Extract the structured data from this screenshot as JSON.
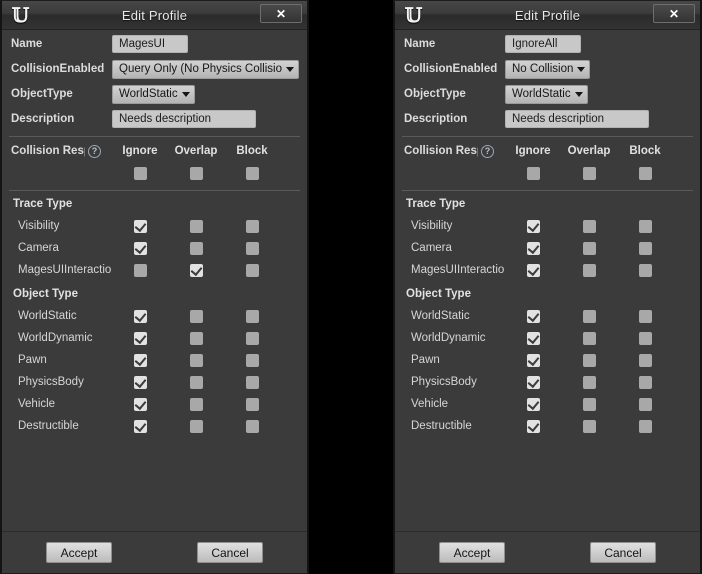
{
  "window": {
    "title": "Edit Profile",
    "logo_icon": "unreal-engine-logo",
    "close_icon": "✕"
  },
  "labels": {
    "name": "Name",
    "collision_enabled": "CollisionEnabled",
    "object_type": "ObjectType",
    "description": "Description",
    "collision_response": "Collision Resp",
    "help_icon": "?",
    "trace_type_section": "Trace Type",
    "object_type_section": "Object Type",
    "col_ignore": "Ignore",
    "col_overlap": "Overlap",
    "col_block": "Block"
  },
  "buttons": {
    "accept": "Accept",
    "cancel": "Cancel"
  },
  "panels": [
    {
      "id": "left",
      "name_value": "MagesUI",
      "collision_enabled_value": "Query Only (No Physics Collision)",
      "object_type_value": "WorldStatic",
      "description_value": "Needs description",
      "collision_response_row": {
        "ignore": false,
        "overlap": false,
        "block": false
      },
      "trace_types": [
        {
          "label": "Visibility",
          "ignore": true,
          "overlap": false,
          "block": false
        },
        {
          "label": "Camera",
          "ignore": true,
          "overlap": false,
          "block": false
        },
        {
          "label": "MagesUIInteraction",
          "ignore": false,
          "overlap": true,
          "block": false
        }
      ],
      "object_types": [
        {
          "label": "WorldStatic",
          "ignore": true,
          "overlap": false,
          "block": false
        },
        {
          "label": "WorldDynamic",
          "ignore": true,
          "overlap": false,
          "block": false
        },
        {
          "label": "Pawn",
          "ignore": true,
          "overlap": false,
          "block": false
        },
        {
          "label": "PhysicsBody",
          "ignore": true,
          "overlap": false,
          "block": false
        },
        {
          "label": "Vehicle",
          "ignore": true,
          "overlap": false,
          "block": false
        },
        {
          "label": "Destructible",
          "ignore": true,
          "overlap": false,
          "block": false
        }
      ]
    },
    {
      "id": "right",
      "name_value": "IgnoreAll",
      "collision_enabled_value": "No Collision",
      "object_type_value": "WorldStatic",
      "description_value": "Needs description",
      "collision_response_row": {
        "ignore": false,
        "overlap": false,
        "block": false
      },
      "trace_types": [
        {
          "label": "Visibility",
          "ignore": true,
          "overlap": false,
          "block": false
        },
        {
          "label": "Camera",
          "ignore": true,
          "overlap": false,
          "block": false
        },
        {
          "label": "MagesUIInteraction",
          "ignore": true,
          "overlap": false,
          "block": false
        }
      ],
      "object_types": [
        {
          "label": "WorldStatic",
          "ignore": true,
          "overlap": false,
          "block": false
        },
        {
          "label": "WorldDynamic",
          "ignore": true,
          "overlap": false,
          "block": false
        },
        {
          "label": "Pawn",
          "ignore": true,
          "overlap": false,
          "block": false
        },
        {
          "label": "PhysicsBody",
          "ignore": true,
          "overlap": false,
          "block": false
        },
        {
          "label": "Vehicle",
          "ignore": true,
          "overlap": false,
          "block": false
        },
        {
          "label": "Destructible",
          "ignore": true,
          "overlap": false,
          "block": false
        }
      ]
    }
  ],
  "colors": {
    "panel_bg": "#3b3b3b",
    "gap_bg": "#000000",
    "checkbox_off": "#a8a8a8",
    "checkbox_on": "#e2e2e2",
    "input_bg": "#c8c8c8"
  }
}
